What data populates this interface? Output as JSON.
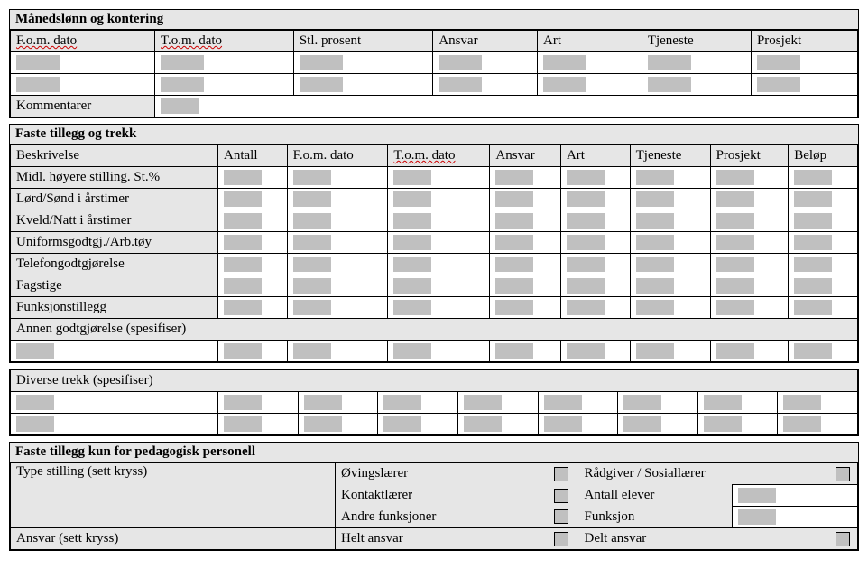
{
  "section1": {
    "title": "Månedslønn og kontering",
    "headers": {
      "fom": "F.o.m. dato",
      "tom": "T.o.m. dato",
      "stl": "Stl. prosent",
      "ansvar": "Ansvar",
      "art": "Art",
      "tjeneste": "Tjeneste",
      "prosjekt": "Prosjekt"
    },
    "kommentarer": "Kommentarer"
  },
  "section2": {
    "title": "Faste tillegg og trekk",
    "headers": {
      "beskrivelse": "Beskrivelse",
      "antall": "Antall",
      "fom": "F.o.m. dato",
      "tom": "T.o.m. dato",
      "ansvar": "Ansvar",
      "art": "Art",
      "tjeneste": "Tjeneste",
      "prosjekt": "Prosjekt",
      "belop": "Beløp"
    },
    "rows": {
      "r1": "Midl. høyere stilling. St.%",
      "r2": "Lørd/Sønd i årstimer",
      "r3": "Kveld/Natt i årstimer",
      "r4": "Uniformsgodtgj./Arb.tøy",
      "r5": "Telefongodtgjørelse",
      "r6": "Fagstige",
      "r7": "Funksjonstillegg"
    },
    "annen": "Annen godtgjørelse (spesifiser)"
  },
  "section3": {
    "title": "Diverse trekk (spesifiser)"
  },
  "section4": {
    "title": "Faste tillegg kun for pedagogisk personell",
    "type_stilling": "Type stilling (sett kryss)",
    "ovingslarer": "Øvingslærer",
    "kontaktlarer": "Kontaktlærer",
    "andre": "Andre funksjoner",
    "radgiver": "Rådgiver / Sosiallærer",
    "antall_elever": "Antall elever",
    "funksjon": "Funksjon",
    "ansvar": "Ansvar (sett kryss)",
    "helt": "Helt ansvar",
    "delt": "Delt ansvar"
  }
}
